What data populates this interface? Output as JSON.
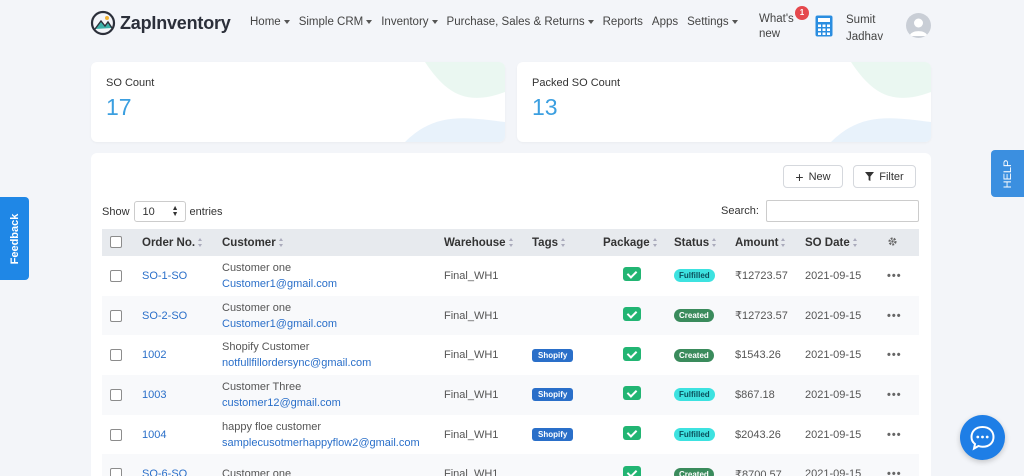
{
  "brand": {
    "name": "ZapInventory"
  },
  "nav": {
    "items": [
      {
        "label": "Home",
        "dropdown": true
      },
      {
        "label": "Simple CRM",
        "dropdown": true
      },
      {
        "label": "Inventory",
        "dropdown": true
      },
      {
        "label": "Purchase, Sales & Returns",
        "dropdown": true
      },
      {
        "label": "Reports",
        "dropdown": false
      },
      {
        "label": "Apps",
        "dropdown": false
      },
      {
        "label": "Settings",
        "dropdown": true
      }
    ],
    "whats_new_line1": "What's",
    "whats_new_line2": "new",
    "whats_new_badge": "1",
    "user_first": "Sumit",
    "user_last": "Jadhav"
  },
  "stats": {
    "so_count_label": "SO Count",
    "so_count_value": "17",
    "packed_label": "Packed SO Count",
    "packed_value": "13"
  },
  "toolbar": {
    "new_label": "New",
    "filter_label": "Filter",
    "show_label": "Show",
    "entries_value": "10",
    "entries_label": "entries",
    "search_label": "Search:"
  },
  "table": {
    "columns": [
      "Order No.",
      "Customer",
      "Warehouse",
      "Tags",
      "Package",
      "Status",
      "Amount",
      "SO Date"
    ],
    "rows": [
      {
        "order": "SO-1-SO",
        "customer": "Customer one",
        "email": "Customer1@gmail.com",
        "warehouse": "Final_WH1",
        "tag": "",
        "status": "Fulfilled",
        "amount": "₹12723.57",
        "date": "2021-09-15"
      },
      {
        "order": "SO-2-SO",
        "customer": "Customer one",
        "email": "Customer1@gmail.com",
        "warehouse": "Final_WH1",
        "tag": "",
        "status": "Created",
        "amount": "₹12723.57",
        "date": "2021-09-15"
      },
      {
        "order": "1002",
        "customer": "Shopify Customer",
        "email": "notfullfillordersync@gmail.com",
        "warehouse": "Final_WH1",
        "tag": "Shopify",
        "status": "Created",
        "amount": "$1543.26",
        "date": "2021-09-15"
      },
      {
        "order": "1003",
        "customer": "Customer Three",
        "email": "customer12@gmail.com",
        "warehouse": "Final_WH1",
        "tag": "Shopify",
        "status": "Fulfilled",
        "amount": "$867.18",
        "date": "2021-09-15"
      },
      {
        "order": "1004",
        "customer": "happy floe customer",
        "email": "samplecusotmerhappyflow2@gmail.com",
        "warehouse": "Final_WH1",
        "tag": "Shopify",
        "status": "Fulfilled",
        "amount": "$2043.26",
        "date": "2021-09-15"
      },
      {
        "order": "SO-6-SO",
        "customer": "Customer one",
        "email": "",
        "warehouse": "Final_WH1",
        "tag": "",
        "status": "Created",
        "amount": "₹8700.57",
        "date": "2021-09-15"
      }
    ]
  },
  "side": {
    "feedback": "Feedback",
    "help": "HELP"
  },
  "colors": {
    "accent": "#3b9fe0",
    "primary": "#1f87e6",
    "fulfilled": "#3de2e0",
    "created": "#3a8b5c",
    "package": "#22b573"
  }
}
